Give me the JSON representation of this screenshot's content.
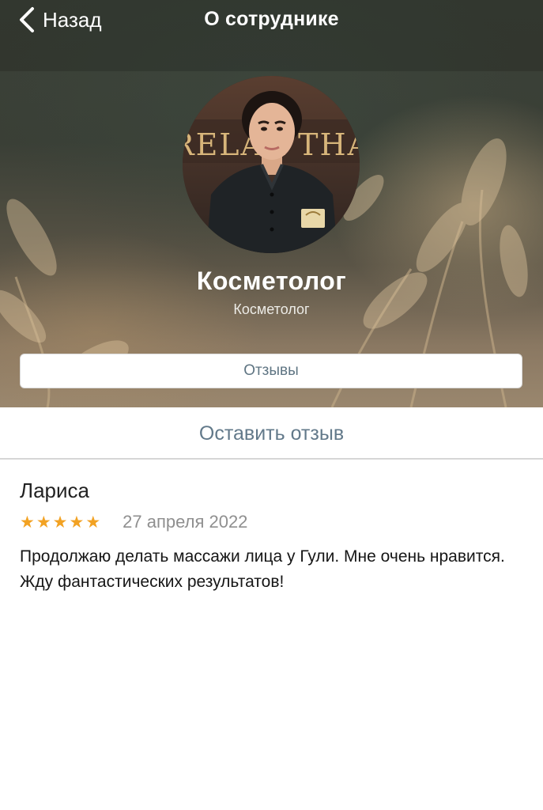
{
  "nav": {
    "back_label": "Назад",
    "title": "О сотруднике"
  },
  "employee": {
    "name": "Косметолог",
    "role": "Косметолог",
    "photo_sign_text": "RELAX THA"
  },
  "tabs": {
    "reviews_label": "Отзывы"
  },
  "actions": {
    "leave_review_label": "Оставить отзыв"
  },
  "reviews": [
    {
      "author": "Лариса",
      "rating": 5,
      "max_rating": 5,
      "stars": [
        "★",
        "★",
        "★",
        "★",
        "★"
      ],
      "date": "27 апреля 2022",
      "text": "Продолжаю делать массажи лица у Гули. Мне очень нравится. Жду фантастических результатов!"
    }
  ],
  "colors": {
    "star": "#f2a223",
    "link_text": "#62798a",
    "button_text": "#5f7583",
    "header_text": "#ffffff"
  }
}
